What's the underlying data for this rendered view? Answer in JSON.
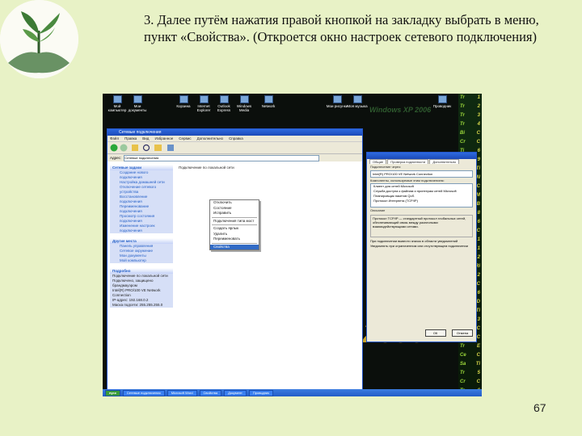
{
  "slide": {
    "title": "3. Далее путём нажатия правой кнопкой на закладку выбрать в меню, пункт «Свойства». (Откроется окно настроек сетевого подключения)",
    "page_number": "67"
  },
  "screenshot": {
    "desktop_brand": "Windows XP 2006",
    "desktop_year": "2006",
    "right_column_rows": [
      [
        "Tr",
        "1"
      ],
      [
        "Tr",
        "2"
      ],
      [
        "Tr",
        "3"
      ],
      [
        "Tr",
        "4"
      ],
      [
        "Bi",
        "C"
      ],
      [
        "Cr",
        "C"
      ],
      [
        "Ti",
        "6"
      ],
      [
        "Ta",
        "9"
      ],
      [
        "Bi",
        "Ti"
      ],
      [
        "Tr",
        "N"
      ],
      [
        "Cr",
        "C"
      ],
      [
        "Tr",
        "M"
      ],
      [
        "Cr",
        "B"
      ],
      [
        "Tr",
        "8"
      ],
      [
        "Bu",
        "6"
      ],
      [
        "Sa",
        "C"
      ],
      [
        "Tr",
        "1"
      ],
      [
        "Cr",
        "1"
      ],
      [
        "Tr",
        "2"
      ],
      [
        "Bu",
        "Ri"
      ],
      [
        "Tr",
        "2"
      ],
      [
        "Sa",
        "C"
      ],
      [
        "Tr",
        "6"
      ],
      [
        "Tr",
        "D"
      ],
      [
        "Ti",
        "Ti"
      ],
      [
        "Tr",
        "3"
      ],
      [
        "Cr",
        "C"
      ],
      [
        "Tr",
        "C"
      ],
      [
        "Tr",
        "E"
      ],
      [
        "Ce",
        "C"
      ],
      [
        "Sa",
        "Ti"
      ],
      [
        "Tr",
        "5"
      ],
      [
        "Cr",
        "C"
      ],
      [
        "Tr",
        "6"
      ]
    ],
    "window": {
      "title": "Сетевые подключения",
      "menu": [
        "Файл",
        "Правка",
        "Вид",
        "Избранное",
        "Сервис",
        "Дополнительно",
        "Справка"
      ],
      "address_label": "Адрес:",
      "address": "Сетевые подключения",
      "connection_name": "Подключение по локальной сети",
      "task_groups": [
        {
          "header": "Сетевые задачи",
          "items": [
            "Создание нового подключения",
            "Настройка домашней сети",
            "Отключение сетевого устройства",
            "Восстановление подключения",
            "Переименование подключения",
            "Просмотр состояния подключения",
            "Изменение настроек подключения"
          ]
        },
        {
          "header": "Другие места",
          "items": [
            "Панель управления",
            "Сетевое окружение",
            "Мои документы",
            "Мой компьютер"
          ]
        }
      ],
      "details": {
        "header": "Подробно",
        "lines": [
          "Подключение по локальной сети",
          "Подключено, защищено брандмауэром",
          "Intel(R) PRO/100 VE Network Connection",
          "IP-адрес: 192.168.0.2",
          "Маска подсети: 255.255.255.0"
        ]
      }
    },
    "context_menu": [
      "Отключить",
      "Состояние",
      "Исправить",
      "-",
      "Подключения типа мост",
      "-",
      "Создать ярлык",
      "Удалить",
      "Переименовать",
      "-",
      "Свойства"
    ],
    "context_selected": "Свойства",
    "dialog": {
      "tabs": [
        "Общие",
        "Проверка подлинности",
        "Дополнительно"
      ],
      "connect_via_label": "Подключение через:",
      "adapter": "Intel(R) PRO/100 VE Network Connection",
      "components_label": "Компоненты, используемые этим подключением:",
      "components": [
        "Клиент для сетей Microsoft",
        "Служба доступа к файлам и принтерам сетей Microsoft",
        "Планировщик пакетов QoS",
        "Протокол Интернета (TCP/IP)"
      ],
      "description_label": "Описание",
      "description": "Протокол TCP/IP — стандартный протокол глобальных сетей, обеспечивающий связь между различными взаимодействующими сетями.",
      "checkboxes": [
        "При подключении вывести значок в области уведомлений",
        "Уведомлять при ограниченном или отсутствующем подключении"
      ],
      "buttons": [
        "ОК",
        "Отмена"
      ]
    },
    "desktop_icons": [
      "Мой компьютер",
      "Мои документы",
      "Корзина",
      "Internet Explorer",
      "Outlook Express",
      "Windows Media",
      "Network",
      "Мои рисунки",
      "Моя музыка",
      "Проводник"
    ],
    "taskbar_buttons": [
      "пуск",
      "Сетевые подключения",
      "Microsoft Word",
      "Свойства",
      "Документ",
      "Проводник"
    ]
  }
}
